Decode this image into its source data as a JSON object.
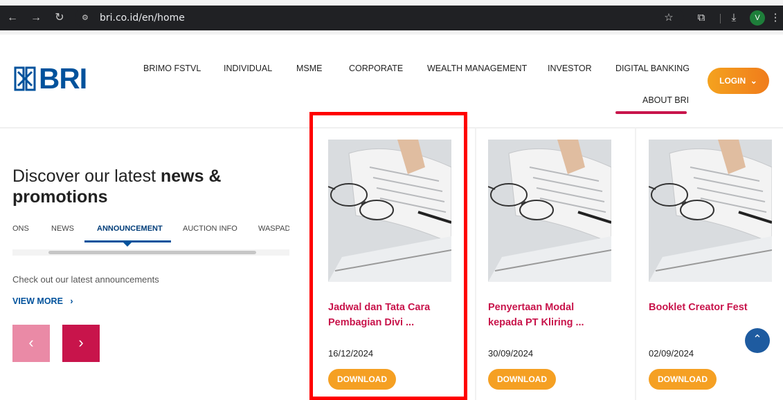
{
  "browser": {
    "url": "bri.co.id/en/home",
    "avatar_letter": "V"
  },
  "site": {
    "logo_text": "BRI",
    "menu": [
      "BRIMO FSTVL",
      "INDIVIDUAL",
      "MSME",
      "CORPORATE",
      "WEALTH MANAGEMENT",
      "INVESTOR",
      "DIGITAL BANKING"
    ],
    "about": "ABOUT BRI",
    "login": "LOGIN"
  },
  "news": {
    "headline_part1": "Discover our latest ",
    "headline_bold": "news &",
    "headline_line2": "promotions",
    "tabs": [
      "ONS",
      "NEWS",
      "ANNOUNCEMENT",
      "AUCTION INFO",
      "WASPADA"
    ],
    "active_tab": "ANNOUNCEMENT",
    "description": "Check out our latest announcements",
    "view_more": "VIEW MORE"
  },
  "cards": [
    {
      "title_line1": "Jadwal dan Tata Cara",
      "title_line2": "Pembagian Divi ...",
      "date": "16/12/2024",
      "button": "DOWNLOAD"
    },
    {
      "title_line1": "Penyertaan Modal",
      "title_line2": "kepada PT Kliring ...",
      "date": "30/09/2024",
      "button": "DOWNLOAD"
    },
    {
      "title_line1": "Booklet Creator Fest",
      "title_line2": "",
      "date": "02/09/2024",
      "button": "DOWNLOAD"
    }
  ],
  "colors": {
    "brand_blue": "#00529c",
    "brand_red": "#c8144b",
    "accent_orange": "#f5a023",
    "highlight": "#ff0000"
  }
}
